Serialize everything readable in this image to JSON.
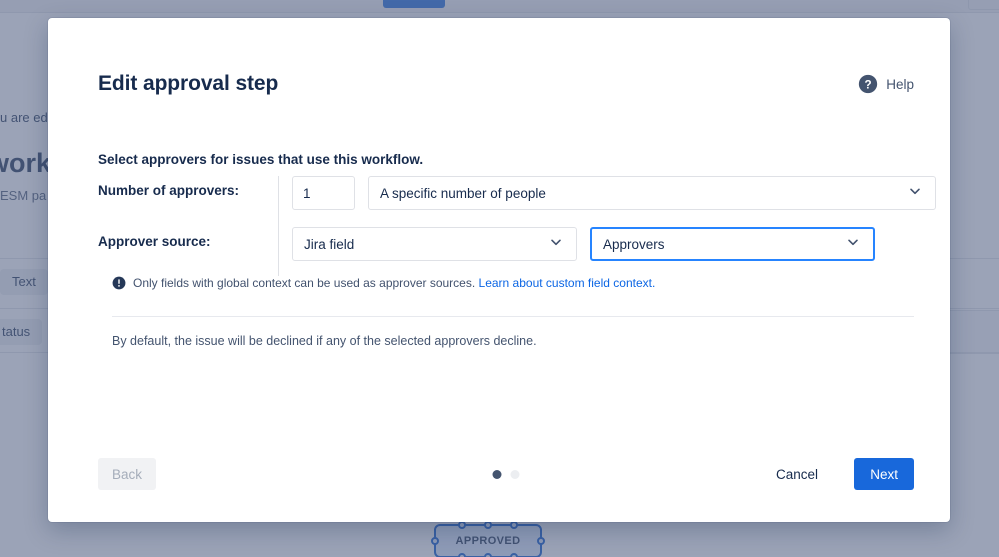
{
  "background": {
    "banner_text": "u are edi",
    "heading": "workfl",
    "subheading": "ESM pa",
    "chips": [
      {
        "label": "Text"
      },
      {
        "label": "tatus"
      }
    ],
    "node": {
      "label": "APPROVED"
    }
  },
  "modal": {
    "title": "Edit approval step",
    "help_label": "Help",
    "help_icon": "question-circle-icon",
    "subtitle": "Select approvers for issues that use this workflow.",
    "form": {
      "rows": [
        {
          "label": "Number of approvers:",
          "number_value": "1",
          "number_placeholder": "1",
          "select_value": "A specific number of people"
        },
        {
          "label": "Approver source:",
          "select_left_value": "Jira field",
          "select_right_value": "Approvers"
        }
      ],
      "hint": {
        "icon": "info-circle-icon",
        "text": "Only fields with global context can be used as approver sources.",
        "link_text": "Learn about custom field context."
      },
      "note": "By default, the issue will be declined if any of the selected approvers decline."
    },
    "footer": {
      "back_label": "Back",
      "cancel_label": "Cancel",
      "next_label": "Next",
      "dots": [
        {
          "active": true
        },
        {
          "active": false
        }
      ]
    }
  },
  "colors": {
    "primary": "#1868db",
    "focus_border": "#2684ff",
    "link": "#0c66e4",
    "text": "#172b4d",
    "subtle_text": "#44546f",
    "node_border": "#0052cc",
    "node_fill": "#deebff"
  }
}
